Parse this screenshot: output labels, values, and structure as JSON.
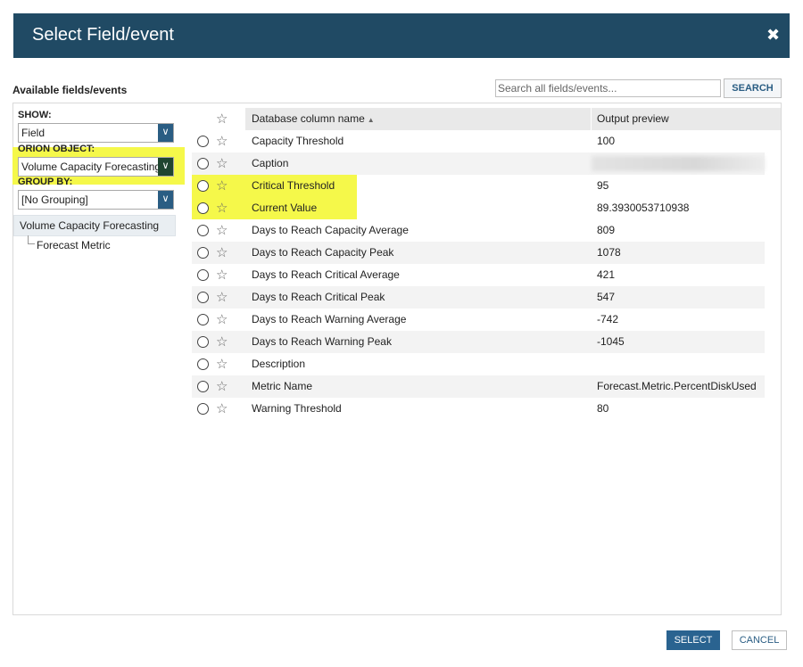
{
  "dialog": {
    "title": "Select Field/event",
    "close_icon": "close-icon"
  },
  "available_label": "Available fields/events",
  "search": {
    "placeholder": "Search all fields/events...",
    "button_label": "SEARCH"
  },
  "left": {
    "show_label": "SHOW:",
    "show_value": "Field",
    "orion_label": "ORION OBJECT:",
    "orion_value": "Volume Capacity Forecasting",
    "group_label": "GROUP BY:",
    "group_value": "[No Grouping]",
    "tree_root": "Volume Capacity Forecasting",
    "tree_child": "Forecast Metric"
  },
  "grid": {
    "col_name": "Database column name",
    "col_preview": "Output preview",
    "rows": [
      {
        "name": "Capacity Threshold",
        "value": "100"
      },
      {
        "name": "Caption",
        "value": ""
      },
      {
        "name": "Critical Threshold",
        "value": "95"
      },
      {
        "name": "Current Value",
        "value": "89.3930053710938"
      },
      {
        "name": "Days to Reach Capacity Average",
        "value": "809"
      },
      {
        "name": "Days to Reach Capacity Peak",
        "value": "1078"
      },
      {
        "name": "Days to Reach Critical Average",
        "value": "421"
      },
      {
        "name": "Days to Reach Critical Peak",
        "value": "547"
      },
      {
        "name": "Days to Reach Warning Average",
        "value": "-742"
      },
      {
        "name": "Days to Reach Warning Peak",
        "value": "-1045"
      },
      {
        "name": "Description",
        "value": ""
      },
      {
        "name": "Metric Name",
        "value": "Forecast.Metric.PercentDiskUsed"
      },
      {
        "name": "Warning Threshold",
        "value": "80"
      }
    ]
  },
  "footer": {
    "select_label": "SELECT",
    "cancel_label": "CANCEL"
  },
  "colors": {
    "titlebar": "#204a64",
    "accent": "#2a6390",
    "highlight": "#f5f84a"
  }
}
